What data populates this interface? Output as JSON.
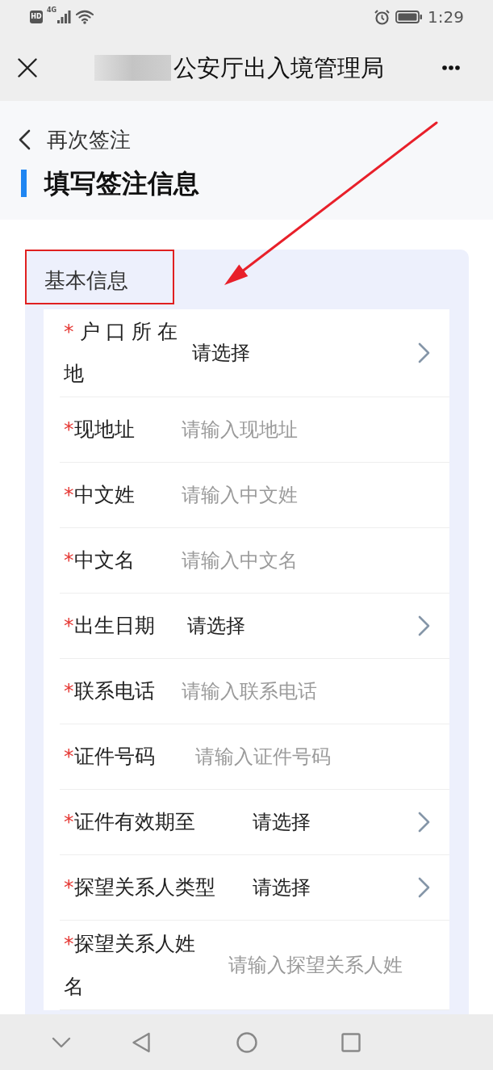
{
  "status_bar": {
    "hd": "HD",
    "network": "4G",
    "time": "1:29"
  },
  "title_bar": {
    "title": "公安厅出入境管理局"
  },
  "back_link": {
    "label": "再次签注"
  },
  "page_heading": "填写签注信息",
  "section": {
    "title": "基本信息",
    "rows": [
      {
        "kind": "select",
        "required_mark": "*",
        "label": "户口所在地",
        "value": "请选择"
      },
      {
        "kind": "input",
        "required_mark": "*",
        "label": "现地址",
        "placeholder": "请输入现地址"
      },
      {
        "kind": "input",
        "required_mark": "*",
        "label": "中文姓",
        "placeholder": "请输入中文姓"
      },
      {
        "kind": "input",
        "required_mark": "*",
        "label": "中文名",
        "placeholder": "请输入中文名"
      },
      {
        "kind": "select",
        "required_mark": "*",
        "label": "出生日期",
        "value": "请选择"
      },
      {
        "kind": "input",
        "required_mark": "*",
        "label": "联系电话",
        "placeholder": "请输入联系电话"
      },
      {
        "kind": "input",
        "required_mark": "*",
        "label": "证件号码",
        "placeholder": "请输入证件号码"
      },
      {
        "kind": "select",
        "required_mark": "*",
        "label": "证件有效期至",
        "value": "请选择"
      },
      {
        "kind": "select",
        "required_mark": "*",
        "label": "探望关系人类型",
        "value": "请选择"
      },
      {
        "kind": "input",
        "required_mark": "*",
        "label": "探望关系人姓名",
        "placeholder": "请输入探望关系人姓"
      }
    ]
  }
}
